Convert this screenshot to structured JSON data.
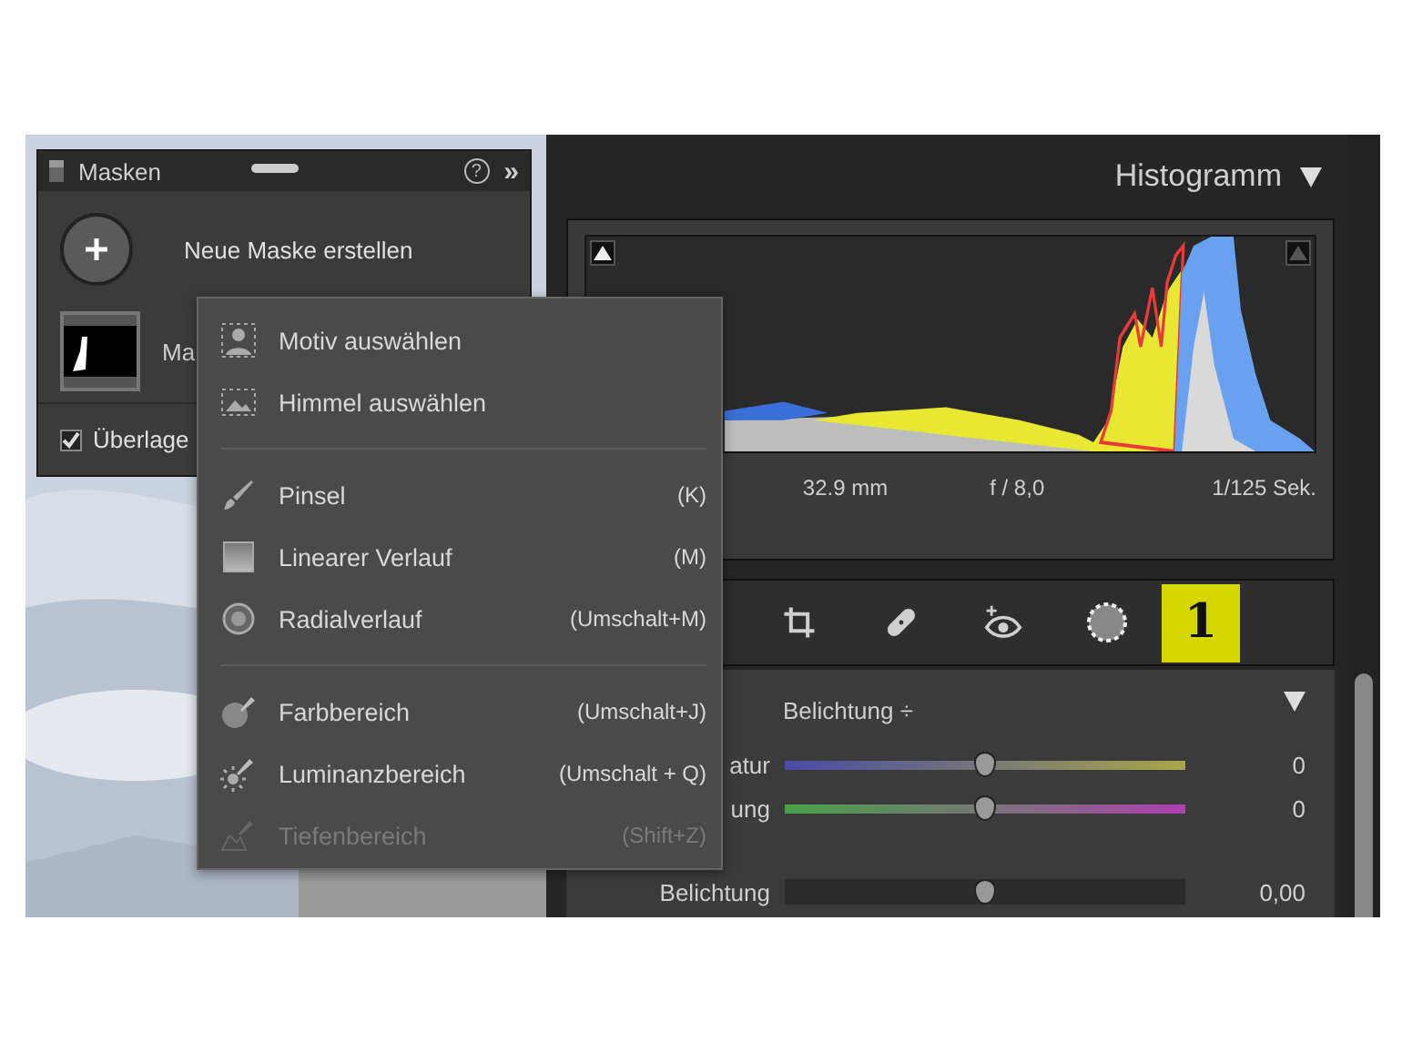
{
  "masks_panel": {
    "title": "Masken",
    "help": "?",
    "collapse": "»",
    "new_mask_label": "Neue Maske erstellen",
    "mask_name": "Ma",
    "overlay": {
      "label": "Überlage",
      "checked": true
    }
  },
  "histogram": {
    "title": "Histogramm",
    "expanded": true,
    "info": [
      "32.9 mm",
      "f / 8,0",
      "1/125 Sek."
    ]
  },
  "tools": [
    {
      "kind": "crop",
      "selected": false
    },
    {
      "kind": "heal",
      "selected": false
    },
    {
      "kind": "redeye",
      "selected": false
    },
    {
      "kind": "mask",
      "selected": true
    }
  ],
  "annotation": "1",
  "mask_adjust": {
    "preset": "Belichtung",
    "preset_arrow": "÷",
    "expanded": true,
    "sliders": [
      {
        "label": "atur",
        "kind": "temp",
        "level": 0.5,
        "value": "0"
      },
      {
        "label": "ung",
        "kind": "tint",
        "level": 0.5,
        "value": "0"
      },
      {
        "label": "Belichtung",
        "kind": "plain",
        "level": 0.5,
        "value": "0,00"
      }
    ]
  },
  "menu": {
    "sections": [
      [
        {
          "kind": "subject",
          "label": "Motiv auswählen",
          "disabled": false
        },
        {
          "kind": "sky",
          "label": "Himmel auswählen",
          "disabled": false
        }
      ],
      [
        {
          "kind": "brush",
          "label": "Pinsel",
          "shortcut": "(K)",
          "disabled": false
        },
        {
          "kind": "linear",
          "label": "Linearer Verlauf",
          "shortcut": "(M)",
          "disabled": false
        },
        {
          "kind": "radial",
          "label": "Radialverlauf",
          "shortcut": "(Umschalt+M)",
          "disabled": false
        }
      ],
      [
        {
          "kind": "color",
          "label": "Farbbereich",
          "shortcut": "(Umschalt+J)",
          "disabled": false
        },
        {
          "kind": "luminance",
          "label": "Luminanzbereich",
          "shortcut": "(Umschalt + Q)",
          "disabled": false
        },
        {
          "kind": "depth",
          "label": "Tiefenbereich",
          "shortcut": "(Shift+Z)",
          "disabled": true
        }
      ]
    ]
  }
}
